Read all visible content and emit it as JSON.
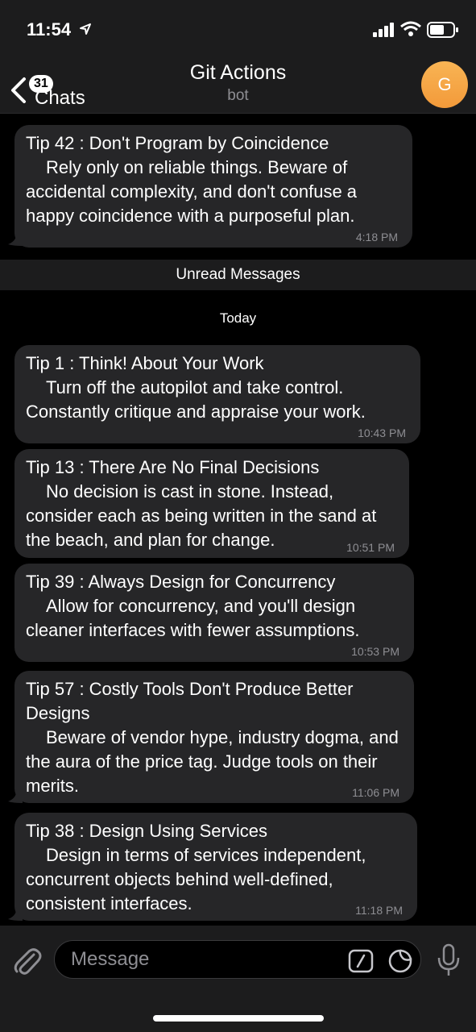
{
  "status_bar": {
    "time": "11:54"
  },
  "nav": {
    "back_badge": "31",
    "back_label": "Chats",
    "title": "Git Actions",
    "subtitle": "bot",
    "avatar_letter": "G"
  },
  "messages": [
    {
      "title": "Tip 42 : Don't Program by Coincidence",
      "body": "Rely only on reliable things. Beware of accidental complexity, and don't confuse a happy coincidence with a purposeful plan.",
      "time": "4:18 PM"
    },
    {
      "title": "Tip 1 : Think! About Your Work",
      "body": "Turn off the autopilot and take control. Constantly critique and appraise your work.",
      "time": "10:43 PM"
    },
    {
      "title": "Tip 13 : There Are No Final Decisions",
      "body": "No decision is cast in stone. Instead, consider each as being written in the sand at the beach, and plan for change.",
      "time": "10:51 PM"
    },
    {
      "title": "Tip 39 : Always Design for Concurrency",
      "body": "Allow for concurrency, and you'll design cleaner interfaces with fewer assumptions.",
      "time": "10:53 PM"
    },
    {
      "title": "Tip 57 : Costly Tools Don't Produce Better Designs",
      "body": "Beware of vendor hype, industry dogma, and the aura of the price tag. Judge tools on their merits.",
      "time": "11:06 PM"
    },
    {
      "title": "Tip 38 : Design Using Services",
      "body": "Design in terms of services independent, concurrent objects behind well-defined, consistent interfaces.",
      "time": "11:18 PM"
    }
  ],
  "dividers": {
    "unread": "Unread Messages",
    "date": "Today"
  },
  "input": {
    "placeholder": "Message"
  },
  "colors": {
    "background": "#000000",
    "bubble": "#262628",
    "bar": "#1c1c1d",
    "avatar": "#f5a347",
    "muted": "#8e8e93"
  },
  "icons": [
    "location-arrow-icon",
    "signal-icon",
    "wifi-icon",
    "battery-icon",
    "back-chevron-icon",
    "attach-icon",
    "bot-command-icon",
    "sticker-icon",
    "microphone-icon"
  ]
}
